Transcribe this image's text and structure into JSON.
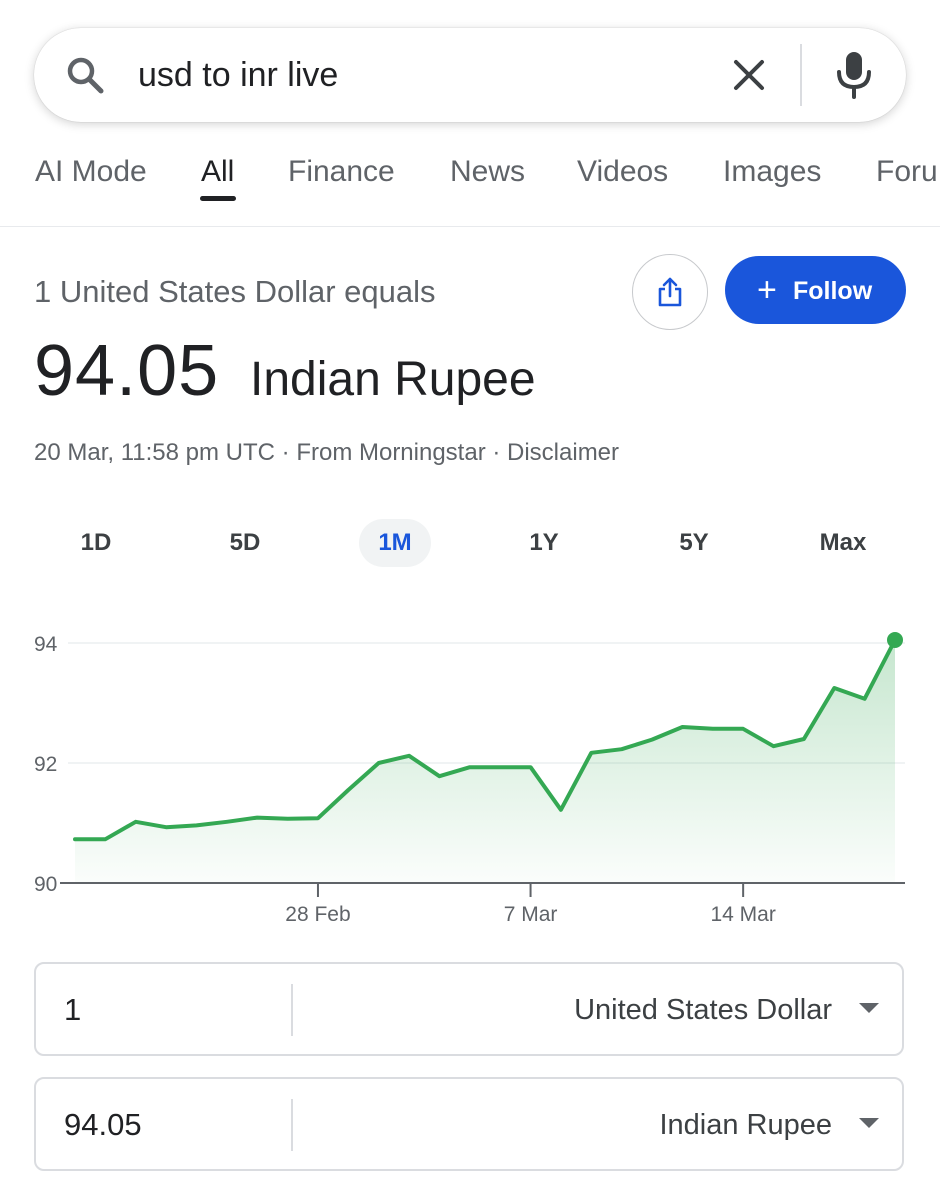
{
  "search": {
    "query": "usd to inr live"
  },
  "tabs": [
    {
      "label": "AI Mode"
    },
    {
      "label": "All",
      "active": true
    },
    {
      "label": "Finance"
    },
    {
      "label": "News"
    },
    {
      "label": "Videos"
    },
    {
      "label": "Images"
    },
    {
      "label": "Foru"
    }
  ],
  "header": {
    "equals_label": "1 United States Dollar equals",
    "follow_label": "Follow",
    "follow_plus": "+",
    "rate_value": "94.05",
    "rate_currency": "Indian Rupee",
    "meta": "20 Mar, 11:58 pm UTC · From Morningstar · Disclaimer"
  },
  "ranges": [
    {
      "label": "1D"
    },
    {
      "label": "5D"
    },
    {
      "label": "1M",
      "active": true
    },
    {
      "label": "1Y"
    },
    {
      "label": "5Y"
    },
    {
      "label": "Max"
    }
  ],
  "chart_data": {
    "type": "area",
    "color": "#34a853",
    "ylim": [
      90,
      94.05
    ],
    "y_ticks": [
      "94",
      "92",
      "90"
    ],
    "x_tick_labels": [
      "28 Feb",
      "7 Mar",
      "14 Mar"
    ],
    "x": [
      "20 Feb",
      "21 Feb",
      "22 Feb",
      "23 Feb",
      "24 Feb",
      "25 Feb",
      "26 Feb",
      "27 Feb",
      "28 Feb",
      "1 Mar",
      "2 Mar",
      "3 Mar",
      "4 Mar",
      "5 Mar",
      "6 Mar",
      "7 Mar",
      "8 Mar",
      "9 Mar",
      "10 Mar",
      "11 Mar",
      "12 Mar",
      "13 Mar",
      "14 Mar",
      "15 Mar",
      "16 Mar",
      "17 Mar",
      "18 Mar",
      "19 Mar",
      "20 Mar"
    ],
    "values": [
      90.73,
      90.73,
      91.02,
      90.93,
      90.96,
      91.02,
      91.09,
      91.07,
      91.08,
      91.55,
      92.0,
      92.12,
      91.78,
      91.93,
      91.93,
      91.93,
      91.22,
      92.17,
      92.23,
      92.39,
      92.6,
      92.57,
      92.57,
      92.28,
      92.4,
      93.25,
      93.07,
      94.05
    ],
    "grid": true
  },
  "converter": {
    "from": {
      "amount": "1",
      "currency": "United States Dollar"
    },
    "to": {
      "amount": "94.05",
      "currency": "Indian Rupee"
    }
  }
}
